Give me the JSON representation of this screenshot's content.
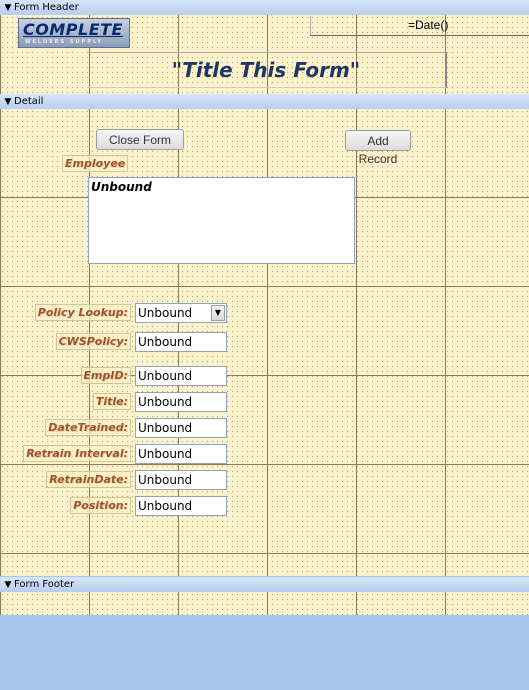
{
  "sections": {
    "header": "Form Header",
    "detail": "Detail",
    "footer": "Form Footer"
  },
  "header": {
    "logo_text": "COMPLETE",
    "logo_subtext": "WELDERS SUPPLY",
    "date_expr": "=Date()",
    "title": "\"Title This Form\""
  },
  "detail": {
    "close_button": "Close Form",
    "add_button": "Add Record",
    "employee_label": "Employee",
    "employee_subform": "Unbound",
    "fields": [
      {
        "label": "Policy Lookup:",
        "value": "Unbound"
      },
      {
        "label": "CWSPolicy:",
        "value": "Unbound"
      },
      {
        "label": "EmpID:",
        "value": "Unbound"
      },
      {
        "label": "Title:",
        "value": "Unbound"
      },
      {
        "label": "DateTrained:",
        "value": "Unbound"
      },
      {
        "label": "Retrain Interval:",
        "value": "Unbound"
      },
      {
        "label": "RetrainDate:",
        "value": "Unbound"
      },
      {
        "label": "Position:",
        "value": "Unbound"
      }
    ]
  },
  "icons": {
    "section_toggle": "collapse-arrow-icon",
    "combo": "dropdown-arrow-icon"
  }
}
